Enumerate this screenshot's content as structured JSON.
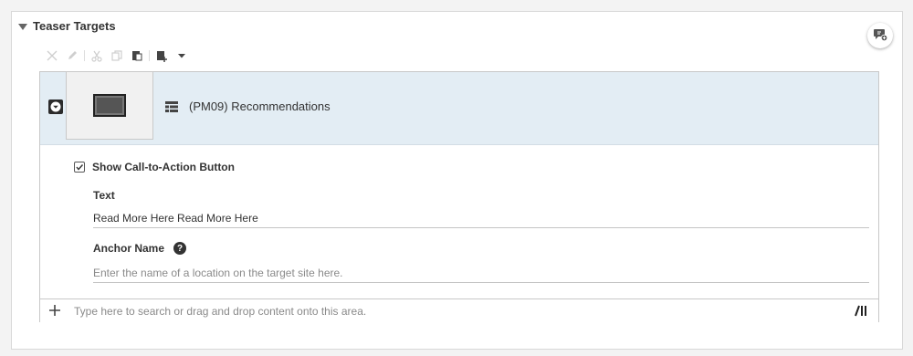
{
  "section": {
    "title": "Teaser Targets",
    "toggle_icon": "triangle-down-icon",
    "comment_icon": "add-comment-icon"
  },
  "toolbar": {
    "icons": [
      "remove-icon",
      "edit-icon",
      "cut-icon",
      "copy-icon",
      "paste-icon",
      "insert-icon",
      "dropdown-icon"
    ]
  },
  "item": {
    "title": "(PM09) Recommendations",
    "type_icon": "list-layout-icon",
    "collapse_icon": "chevron-down-icon",
    "background": "#e3edf4"
  },
  "form": {
    "cta_label": "Show Call-to-Action Button",
    "cta_checked": true,
    "text_label": "Text",
    "text_value": "Read More Here Read More Here",
    "anchor_label": "Anchor Name",
    "anchor_help_glyph": "?",
    "anchor_placeholder": "Enter the name of a location on the target site here."
  },
  "drop_area": {
    "placeholder": "Type here to search or drag and drop content onto this area.",
    "add_icon": "plus-icon",
    "library_icon": "library-icon"
  }
}
